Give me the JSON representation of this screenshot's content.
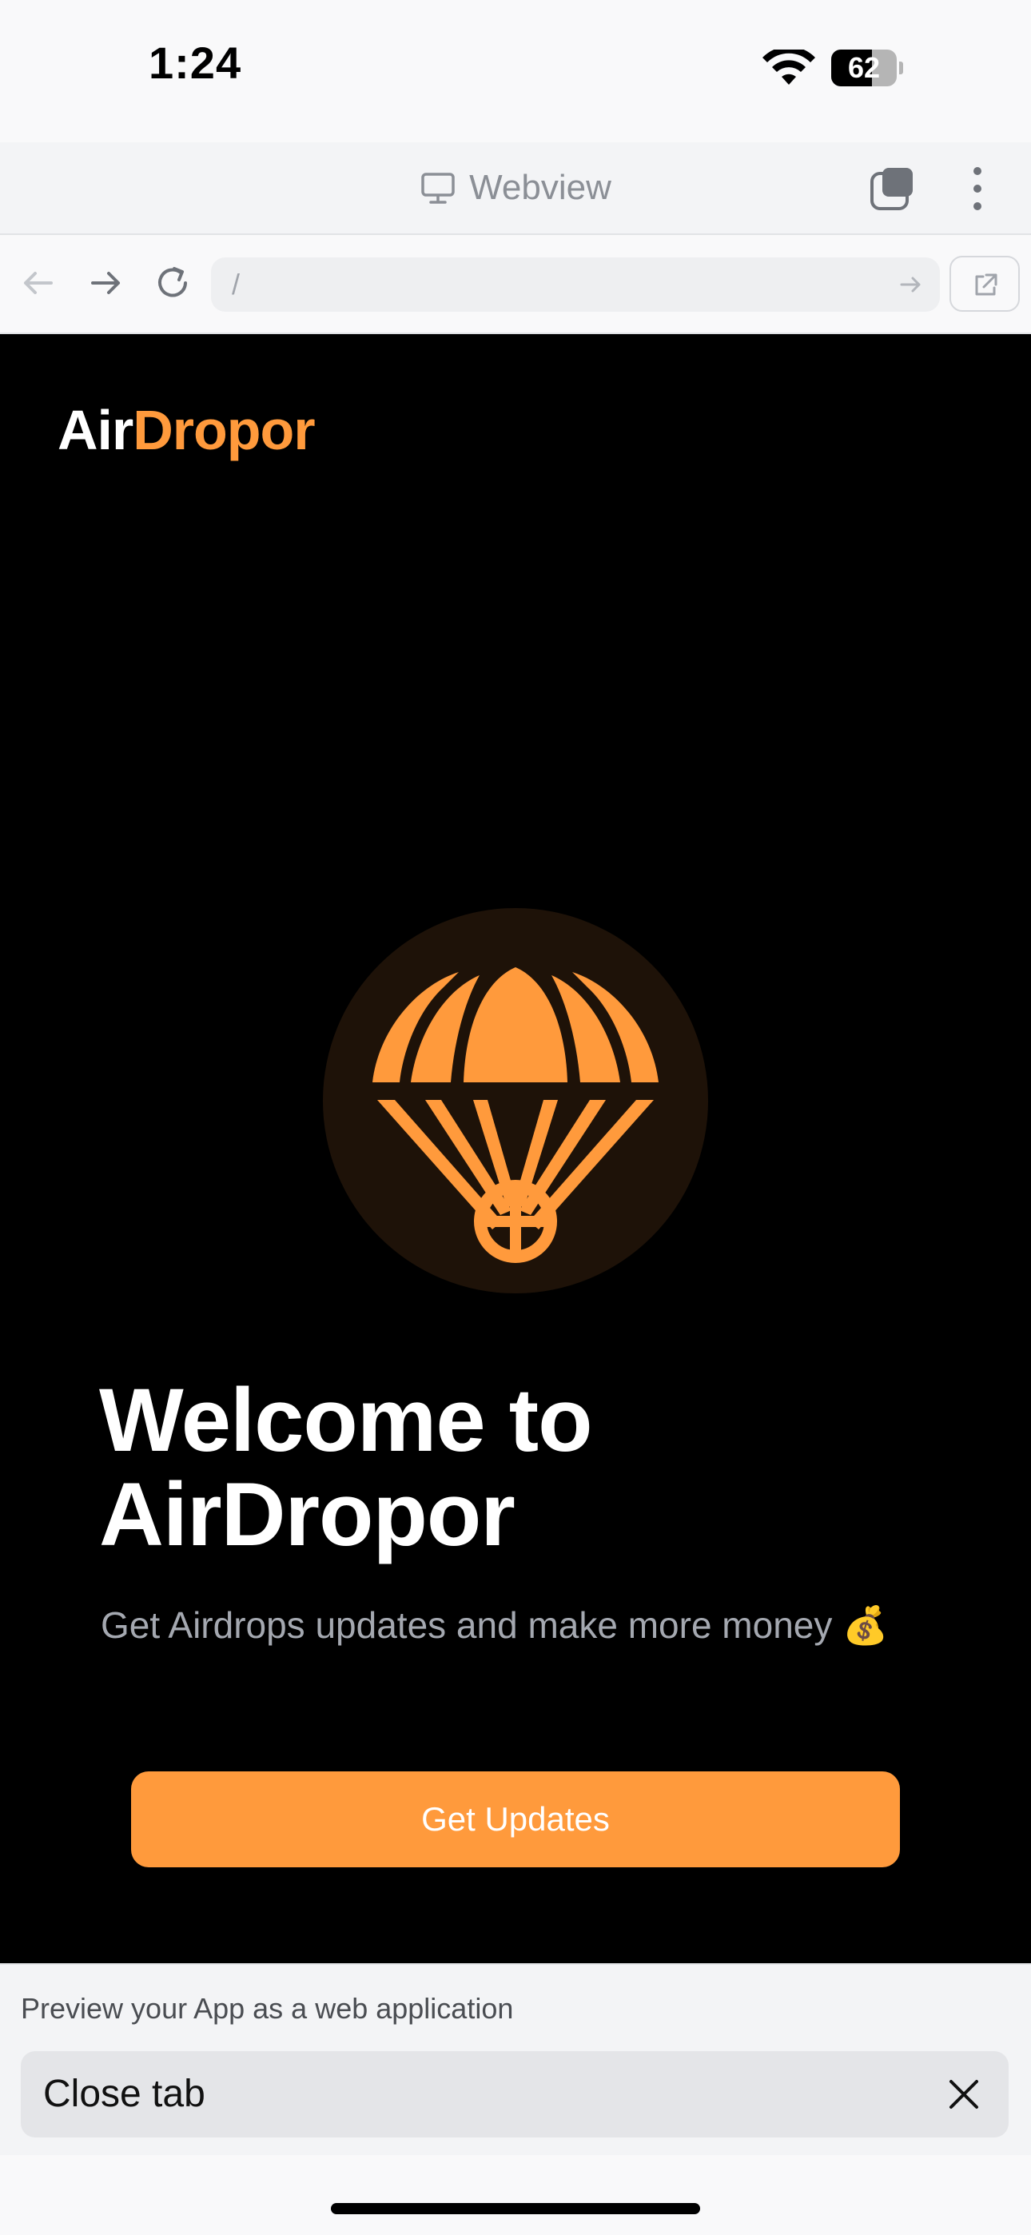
{
  "status_bar": {
    "time": "1:24",
    "battery_percent": "62",
    "battery_level": 0.62,
    "icons": [
      "wifi-icon",
      "battery-icon"
    ]
  },
  "webview_header": {
    "title": "Webview",
    "icons": [
      "monitor-icon",
      "tabs-icon",
      "more-vertical-icon"
    ]
  },
  "address_bar": {
    "url": "/",
    "icons": [
      "back-arrow-icon",
      "forward-arrow-icon",
      "reload-icon",
      "go-arrow-icon",
      "open-external-icon"
    ]
  },
  "app": {
    "logo_part1": "Air",
    "logo_part2": "Dropor",
    "hero_icon": "parachute-icon",
    "welcome_title": "Welcome to AirDropor",
    "subtitle": "Get Airdrops updates and make more money 💰",
    "cta_label": "Get Updates",
    "colors": {
      "accent": "#ff9a3c",
      "background": "#000000",
      "hero_circle": "#1e1208"
    }
  },
  "bottom_panel": {
    "preview_text": "Preview your App as a web application",
    "close_tab_label": "Close tab",
    "icons": [
      "close-icon"
    ]
  }
}
